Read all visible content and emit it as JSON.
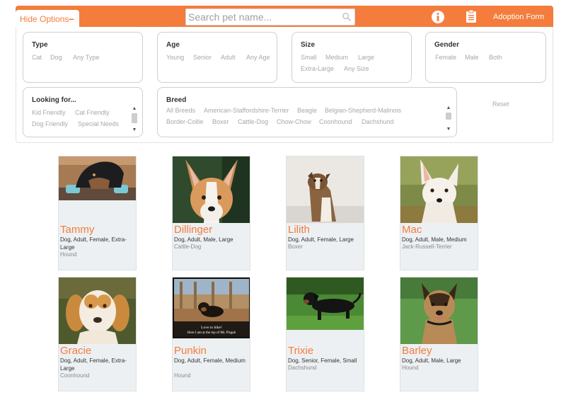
{
  "header": {
    "hide_options_label": "Hide Options",
    "hide_options_icon": "−",
    "search_placeholder": "Search pet name...",
    "adoption_form_label": "Adoption Form",
    "accent_color": "#f47c3c"
  },
  "filters": {
    "type": {
      "title": "Type",
      "options": [
        "Cat",
        "Dog",
        "Any Type"
      ]
    },
    "age": {
      "title": "Age",
      "options": [
        "Young",
        "Senior",
        "Adult",
        "Any Age"
      ]
    },
    "size": {
      "title": "Size",
      "options": [
        "Small",
        "Medium",
        "Large",
        "Extra-Large",
        "Any Size"
      ]
    },
    "gender": {
      "title": "Gender",
      "options": [
        "Female",
        "Male",
        "Both"
      ]
    },
    "looking_for": {
      "title": "Looking for...",
      "options": [
        "Kid Friendly",
        "Cat Friendly",
        "Dog Friendly",
        "Special Needs"
      ]
    },
    "breed": {
      "title": "Breed",
      "options": [
        "All Breeds",
        "American-Staffordshire-Terrier",
        "Beagle",
        "Belgian-Shepherd-Malinois",
        "Border-Collie",
        "Boxer",
        "Cattle-Dog",
        "Chow-Chow",
        "Coonhound",
        "Dachshund"
      ]
    },
    "reset_label": "Reset"
  },
  "pets": [
    {
      "name": "Tammy",
      "desc": "Dog, Adult, Female, Extra-Large",
      "breed": "Hound"
    },
    {
      "name": "Dillinger",
      "desc": "Dog, Adult, Male, Large",
      "breed": "Cattle-Dog"
    },
    {
      "name": "Lilith",
      "desc": "Dog, Adult, Female, Large",
      "breed": "Boxer"
    },
    {
      "name": "Mac",
      "desc": "Dog, Adult, Male, Medium",
      "breed": "Jack-Russell-Terrier"
    },
    {
      "name": "Gracie",
      "desc": "Dog, Adult, Female, Extra-Large",
      "breed": "Coonhound"
    },
    {
      "name": "Punkin",
      "desc": "Dog, Adult, Female, Medium",
      "breed": "Hound",
      "photo_caption": [
        "Love to hike!",
        "Here I am at the top of Mt. Pisgah"
      ]
    },
    {
      "name": "Trixie",
      "desc": "Dog, Senior, Female, Small",
      "breed": "Dachshund"
    },
    {
      "name": "Barley",
      "desc": "Dog, Adult, Male, Large",
      "breed": "Hound"
    }
  ]
}
